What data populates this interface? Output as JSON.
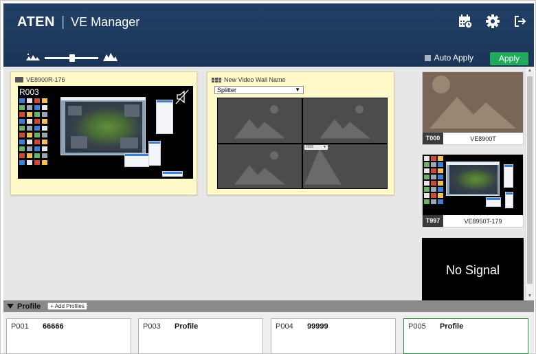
{
  "header": {
    "brand": "ATEN",
    "app_title": "VE Manager",
    "icons": [
      "calendar-schedule-icon",
      "gear-icon",
      "logout-icon"
    ]
  },
  "toolbar": {
    "zoom_out_icon": "small-mountains-icon",
    "zoom_in_icon": "large-mountains-icon",
    "auto_apply_label": "Auto Apply",
    "auto_apply_checked": false,
    "apply_label": "Apply",
    "apply_color": "#21a95d"
  },
  "receiver": {
    "name": "VE8900R-176",
    "screen_label": "R003",
    "muted": true
  },
  "video_wall": {
    "name": "New Video Wall Name",
    "layout_select": "Splitter",
    "cell_dropdown": "2016"
  },
  "transmitters": [
    {
      "id": "T000",
      "name": "VE8900T",
      "state": "placeholder"
    },
    {
      "id": "T997",
      "name": "VE8950T-179",
      "state": "desktop"
    },
    {
      "id": "",
      "name": "",
      "state": "no-signal",
      "signal_text": "No Signal"
    }
  ],
  "profile_bar": {
    "label": "Profile",
    "add_label": "+ Add Profiles"
  },
  "profiles": [
    {
      "id": "P001",
      "name": "66666"
    },
    {
      "id": "P003",
      "name": "Profile"
    },
    {
      "id": "P004",
      "name": "99999"
    },
    {
      "id": "P005",
      "name": "Profile",
      "active": true
    }
  ],
  "colors": {
    "header_bg": "#213f66",
    "panel_bg": "#fff9c9",
    "workspace_bg": "#e7e7e7",
    "active_profile_border": "#2e8b3e"
  }
}
